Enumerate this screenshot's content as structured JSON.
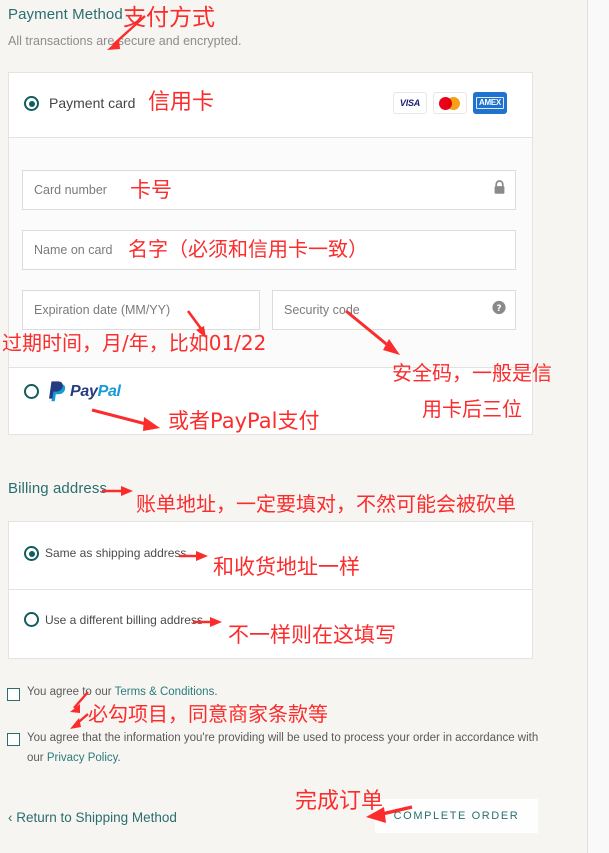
{
  "page": {
    "bg_left": "#f6f5f2",
    "bg_right": "#f9f9f9",
    "accent_teal": "#2b6e6e",
    "annotation_red": "#fb2c2c"
  },
  "payment": {
    "heading": "Payment Method",
    "subheading": "All transactions are secure and encrypted.",
    "card_option_label": "Payment card",
    "brands": [
      {
        "name": "visa-logo",
        "text": "VISA"
      },
      {
        "name": "mastercard-logo",
        "text": ""
      },
      {
        "name": "amex-logo",
        "text": "AMEX"
      }
    ],
    "fields": {
      "card_number_placeholder": "Card number",
      "name_on_card_placeholder": "Name on card",
      "expiration_placeholder": "Expiration date (MM/YY)",
      "security_code_placeholder": "Security code"
    },
    "paypal_label": "PayPal",
    "paypal_word_1": "Pay",
    "paypal_word_2": "Pal"
  },
  "billing": {
    "heading": "Billing address",
    "same_as_shipping_label": "Same as shipping address",
    "different_address_label": "Use a different billing address"
  },
  "agreements": [
    {
      "prefix": "You agree to our ",
      "link": "Terms & Conditions",
      "suffix": "."
    },
    {
      "prefix": "You agree that the information you're providing will be used to process your order in accordance with our ",
      "link": "Privacy Policy",
      "suffix": "."
    }
  ],
  "footer": {
    "return_link": "Return to Shipping Method",
    "return_chevron": "‹",
    "complete_order_label": "COMPLETE ORDER"
  },
  "annotations": [
    {
      "id": "payment-method",
      "text": "支付方式"
    },
    {
      "id": "credit-card",
      "text": "信用卡"
    },
    {
      "id": "card-number",
      "text": "卡号"
    },
    {
      "id": "name-on-card",
      "text": "名字（必须和信用卡一致）"
    },
    {
      "id": "expiration",
      "text": "过期时间，月/年，比如01/22"
    },
    {
      "id": "security-code-l1",
      "text": "安全码，一般是信"
    },
    {
      "id": "security-code-l2",
      "text": "用卡后三位"
    },
    {
      "id": "paypal",
      "text": "或者PayPal支付"
    },
    {
      "id": "billing-address",
      "text": "账单地址，一定要填对，不然可能会被砍单"
    },
    {
      "id": "same-as-shipping",
      "text": "和收货地址一样"
    },
    {
      "id": "different-address",
      "text": "不一样则在这填写"
    },
    {
      "id": "must-check",
      "text": "必勾项目，同意商家条款等"
    },
    {
      "id": "complete-order",
      "text": "完成订单"
    }
  ]
}
